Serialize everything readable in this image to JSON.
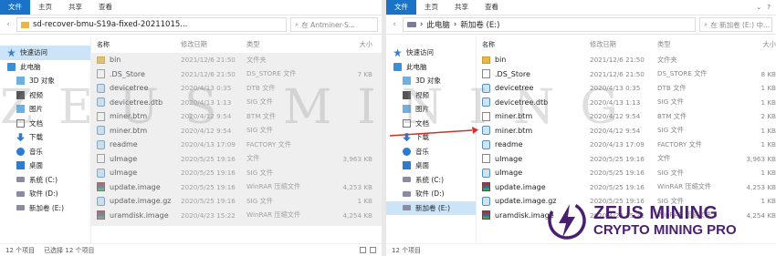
{
  "colors": {
    "accent": "#1a73c6",
    "selection": "#cce4f7",
    "brand": "#4a1f6e",
    "arrow": "#d0312d"
  },
  "left": {
    "ribbon": {
      "tabs": [
        "文件",
        "主页",
        "共享",
        "查看"
      ]
    },
    "path": "sd-recover-bmu-S19a-fixed-20211015...",
    "search_placeholder": "在 Antminer-S...",
    "headers": {
      "name": "名称",
      "date": "修改日期",
      "type": "类型",
      "size": "大小"
    },
    "sidebar": [
      {
        "label": "快速访问",
        "icon": "star-icon",
        "sub": false,
        "sel": true
      },
      {
        "label": "此电脑",
        "icon": "pc-icon",
        "sub": false,
        "sel": false
      },
      {
        "label": "3D 对象",
        "icon": "cube-icon",
        "sub": true,
        "sel": false
      },
      {
        "label": "视频",
        "icon": "video-icon",
        "sub": true,
        "sel": false
      },
      {
        "label": "图片",
        "icon": "picture-icon",
        "sub": true,
        "sel": false
      },
      {
        "label": "文档",
        "icon": "document-icon",
        "sub": true,
        "sel": false
      },
      {
        "label": "下载",
        "icon": "download-icon",
        "sub": true,
        "sel": false
      },
      {
        "label": "音乐",
        "icon": "music-icon",
        "sub": true,
        "sel": false
      },
      {
        "label": "桌面",
        "icon": "desktop-icon",
        "sub": true,
        "sel": false
      },
      {
        "label": "系统 (C:)",
        "icon": "drive-icon",
        "sub": true,
        "sel": false
      },
      {
        "label": "软件 (D:)",
        "icon": "drive-icon",
        "sub": true,
        "sel": false
      },
      {
        "label": "新加卷 (E:)",
        "icon": "drive-icon",
        "sub": true,
        "sel": false
      }
    ],
    "files": [
      {
        "name": "bin",
        "date": "2021/12/6 21:50",
        "type": "文件夹",
        "size": "",
        "icon": "folder"
      },
      {
        "name": ".DS_Store",
        "date": "2021/12/6 21:50",
        "type": "DS_STORE 文件",
        "size": "7 KB",
        "icon": "doc"
      },
      {
        "name": "devicetree",
        "date": "2020/4/13 0:35",
        "type": "DTB 文件",
        "size": "",
        "icon": "sig"
      },
      {
        "name": "devicetree.dtb",
        "date": "2020/4/13 1:13",
        "type": "SIG 文件",
        "size": "",
        "icon": "sig"
      },
      {
        "name": "miner.btm",
        "date": "2020/4/12 9:54",
        "type": "BTM 文件",
        "size": "",
        "icon": "doc"
      },
      {
        "name": "miner.btm",
        "date": "2020/4/12 9:54",
        "type": "SIG 文件",
        "size": "",
        "icon": "sig"
      },
      {
        "name": "readme",
        "date": "2020/4/13 17:09",
        "type": "FACTORY 文件",
        "size": "",
        "icon": "sig"
      },
      {
        "name": "uImage",
        "date": "2020/5/25 19:16",
        "type": "文件",
        "size": "3,963 KB",
        "icon": "doc"
      },
      {
        "name": "uImage",
        "date": "2020/5/25 19:16",
        "type": "SIG 文件",
        "size": "",
        "icon": "sig"
      },
      {
        "name": "update.image",
        "date": "2020/5/25 19:16",
        "type": "WinRAR 压缩文件",
        "size": "4,253 KB",
        "icon": "rar"
      },
      {
        "name": "update.image.gz",
        "date": "2020/5/25 19:16",
        "type": "SIG 文件",
        "size": "1 KB",
        "icon": "sig"
      },
      {
        "name": "uramdisk.image",
        "date": "2020/4/23 15:22",
        "type": "WinRAR 压缩文件",
        "size": "4,254 KB",
        "icon": "rar"
      }
    ],
    "status": {
      "count": "12 个项目",
      "selected": "已选择 12 个项目"
    }
  },
  "right": {
    "ribbon": {
      "tabs": [
        "文件",
        "主页",
        "共享",
        "查看"
      ]
    },
    "path": [
      "此电脑",
      "新加卷 (E:)"
    ],
    "search_placeholder": "在 新加卷 (E:) 中...",
    "headers": {
      "name": "名称",
      "date": "修改日期",
      "type": "类型",
      "size": "大小"
    },
    "sidebar": [
      {
        "label": "快速访问",
        "icon": "star-icon",
        "sub": false,
        "sel": false
      },
      {
        "label": "此电脑",
        "icon": "pc-icon",
        "sub": false,
        "sel": false
      },
      {
        "label": "3D 对象",
        "icon": "cube-icon",
        "sub": true,
        "sel": false
      },
      {
        "label": "视频",
        "icon": "video-icon",
        "sub": true,
        "sel": false
      },
      {
        "label": "图片",
        "icon": "picture-icon",
        "sub": true,
        "sel": false
      },
      {
        "label": "文档",
        "icon": "document-icon",
        "sub": true,
        "sel": false
      },
      {
        "label": "下载",
        "icon": "download-icon",
        "sub": true,
        "sel": false
      },
      {
        "label": "音乐",
        "icon": "music-icon",
        "sub": true,
        "sel": false
      },
      {
        "label": "桌面",
        "icon": "desktop-icon",
        "sub": true,
        "sel": false
      },
      {
        "label": "系统 (C:)",
        "icon": "drive-icon",
        "sub": true,
        "sel": false
      },
      {
        "label": "软件 (D:)",
        "icon": "drive-icon",
        "sub": true,
        "sel": false
      },
      {
        "label": "新加卷 (E:)",
        "icon": "drive-icon",
        "sub": true,
        "sel": true
      }
    ],
    "files": [
      {
        "name": "bin",
        "date": "2021/12/6 21:50",
        "type": "文件夹",
        "size": "",
        "icon": "folder"
      },
      {
        "name": ".DS_Store",
        "date": "2021/12/6 21:50",
        "type": "DS_STORE 文件",
        "size": "8 KB",
        "icon": "doc"
      },
      {
        "name": "devicetree",
        "date": "2020/4/13 0:35",
        "type": "DTB 文件",
        "size": "1 KB",
        "icon": "sig"
      },
      {
        "name": "devicetree.dtb",
        "date": "2020/4/13 1:13",
        "type": "SIG 文件",
        "size": "1 KB",
        "icon": "sig"
      },
      {
        "name": "miner.btm",
        "date": "2020/4/12 9:54",
        "type": "BTM 文件",
        "size": "2 KB",
        "icon": "doc"
      },
      {
        "name": "miner.btm",
        "date": "2020/4/12 9:54",
        "type": "SIG 文件",
        "size": "1 KB",
        "icon": "sig"
      },
      {
        "name": "readme",
        "date": "2020/4/13 17:09",
        "type": "FACTORY 文件",
        "size": "1 KB",
        "icon": "sig"
      },
      {
        "name": "uImage",
        "date": "2020/5/25 19:16",
        "type": "文件",
        "size": "3,963 KB",
        "icon": "doc"
      },
      {
        "name": "uImage",
        "date": "2020/5/25 19:16",
        "type": "SIG 文件",
        "size": "1 KB",
        "icon": "sig"
      },
      {
        "name": "update.image",
        "date": "2020/5/25 19:16",
        "type": "WinRAR 压缩文件",
        "size": "4,253 KB",
        "icon": "rar"
      },
      {
        "name": "update.image.gz",
        "date": "2020/5/25 19:16",
        "type": "SIG 文件",
        "size": "1 KB",
        "icon": "sig"
      },
      {
        "name": "uramdisk.image",
        "date": "2020/4/23 15:22",
        "type": "WinRAR 压缩文件",
        "size": "4,254 KB",
        "icon": "rar"
      }
    ],
    "status": {
      "count": "12 个项目"
    }
  },
  "watermark": "ZEUS MINING",
  "brand": {
    "line1": "ZEUS MINING",
    "line2": "CRYPTO MINING PRO"
  }
}
